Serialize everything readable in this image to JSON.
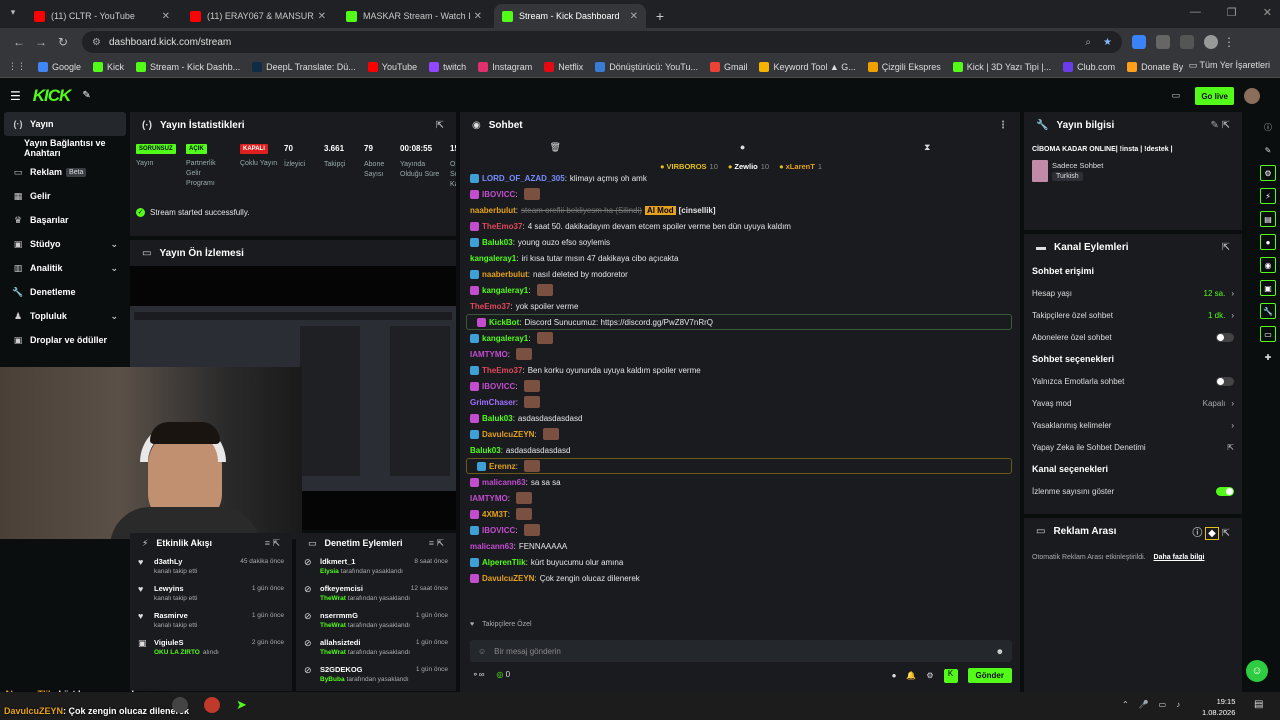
{
  "browser": {
    "tabs": [
      {
        "title": "(11) CLTR - YouTube",
        "color": "#ff0000",
        "active": false
      },
      {
        "title": "(11) ERAY067 & MANSUR",
        "color": "#ff0000",
        "active": false
      },
      {
        "title": "MASKAR Stream - Watch Live o",
        "color": "#53fc18",
        "active": false
      },
      {
        "title": "Stream - Kick Dashboard",
        "color": "#53fc18",
        "active": true
      }
    ],
    "url": "dashboard.kick.com/stream",
    "bookmarks": [
      {
        "label": "Google",
        "color": "#4285f4"
      },
      {
        "label": "Kick",
        "color": "#53fc18"
      },
      {
        "label": "Stream - Kick Dashb...",
        "color": "#53fc18"
      },
      {
        "label": "DeepL Translate: Dü...",
        "color": "#0f2b46"
      },
      {
        "label": "YouTube",
        "color": "#ff0000"
      },
      {
        "label": "twitch",
        "color": "#9146ff"
      },
      {
        "label": "Instagram",
        "color": "#e1306c"
      },
      {
        "label": "Netflix",
        "color": "#e50914"
      },
      {
        "label": "Dönüştürücü: YouTu...",
        "color": "#3a7bd5"
      },
      {
        "label": "Gmail",
        "color": "#ea4335"
      },
      {
        "label": "Keyword Tool ▲ G...",
        "color": "#f4b400"
      },
      {
        "label": "Çizgili Ekspres",
        "color": "#f0a000"
      },
      {
        "label": "Kick | 3D Yazı Tipi |...",
        "color": "#53fc18"
      },
      {
        "label": "Club.com",
        "color": "#6a3de8"
      },
      {
        "label": "Donate ByNoGame...",
        "color": "#ff9f1a"
      }
    ],
    "bookmarks_right": "Tüm Yer İşaretleri"
  },
  "kick": {
    "logo": "KICK",
    "go_live": "Go live"
  },
  "sidebar": {
    "items": [
      {
        "label": "Yayın",
        "icon": "broadcast-icon",
        "active": true
      },
      {
        "label": "Yayın Bağlantısı ve Anahtarı",
        "icon": "",
        "active": false
      },
      {
        "label": "Reklam",
        "icon": "ad-icon",
        "beta": "Beta"
      },
      {
        "label": "Gelir",
        "icon": "money-icon"
      },
      {
        "label": "Başarılar",
        "icon": "trophy-icon"
      },
      {
        "label": "Stüdyo",
        "icon": "studio-icon",
        "chevron": true
      },
      {
        "label": "Analitik",
        "icon": "chart-icon",
        "chevron": true
      },
      {
        "label": "Denetleme",
        "icon": "wrench-icon"
      },
      {
        "label": "Topluluk",
        "icon": "community-icon",
        "chevron": true
      },
      {
        "label": "Droplar ve ödüller",
        "icon": "gift-icon"
      }
    ]
  },
  "stats": {
    "title": "Yayın İstatistikleri",
    "items": [
      {
        "badge": "SORUNSUZ",
        "badge_color": "#53fc18",
        "label": "Yayın"
      },
      {
        "badge": "AÇIK",
        "badge_color": "#53fc18",
        "label": "Partnerlik Gelir Programı"
      },
      {
        "badge": "KAPALI",
        "badge_color": "#e0201f",
        "label": "Çoklu Yayın"
      },
      {
        "value": "70",
        "label": "İzleyici"
      },
      {
        "value": "3.661",
        "label": "Takipçi"
      },
      {
        "value": "79",
        "label": "Abone Sayısı"
      },
      {
        "value": "00:08:55",
        "label": "Yayında Olduğu Süre"
      },
      {
        "value": "15",
        "label": "Or Sc Ka"
      }
    ],
    "success": "Stream started successfully."
  },
  "preview": {
    "title": "Yayın Ön İzlemesi"
  },
  "activity": {
    "title": "Etkinlik Akışı",
    "items": [
      {
        "name": "d3athLy",
        "sub": "kanalı takip etti",
        "time": "45 dakika önce",
        "icon": "heart-icon"
      },
      {
        "name": "Lewyins",
        "sub": "kanalı takip etti",
        "time": "1 gün önce",
        "icon": "heart-icon"
      },
      {
        "name": "Rasmirve",
        "sub": "kanalı takip etti",
        "time": "1 gün önce",
        "icon": "heart-icon"
      },
      {
        "name": "VigiuleS",
        "sub": "OKU LA ZIRTO",
        "sub2": "alındı",
        "time": "2 gün önce",
        "icon": "gift-icon"
      }
    ]
  },
  "modlog": {
    "title": "Denetim Eylemleri",
    "items": [
      {
        "name": "ldkmert_1",
        "by": "Elysia",
        "sub": "tarafından yasaklandı",
        "time": "8 saat önce"
      },
      {
        "name": "ofkeyemcisi",
        "by": "TheWrat",
        "sub": "tarafından yasaklandı",
        "time": "12 saat önce"
      },
      {
        "name": "nserrmmG",
        "by": "TheWrat",
        "sub": "tarafından yasaklandı",
        "time": "1 gün önce"
      },
      {
        "name": "allahsiztedi",
        "by": "TheWrat",
        "sub": "tarafından yasaklandı",
        "time": "1 gün önce"
      },
      {
        "name": "S2GDEKOG",
        "by": "ByBuba",
        "sub": "tarafından yasaklandı",
        "time": "1 gün önce"
      }
    ]
  },
  "chat": {
    "title": "Sohbet",
    "leaders": [
      {
        "name": "VIRBOROS",
        "count": "10"
      },
      {
        "name": "Zewlio",
        "count": "10"
      },
      {
        "name": "xLarenT",
        "count": "1"
      }
    ],
    "messages": [
      {
        "user": "LORD_OF_AZAD_305",
        "color": "#7b8cff",
        "text": "klimayı açmış oh amk"
      },
      {
        "user": "IBOVICC",
        "color": "#c34ccf",
        "text": "",
        "emote": true
      },
      {
        "user": "naaberbulut",
        "color": "#e6a21a",
        "text": "steam oreflii bekliyesm ha (Silindi)",
        "tag": "AI Mod",
        "tag2": "[cinsellik]"
      },
      {
        "user": "TheEmo37",
        "color": "#e0485a",
        "text": "4 saat 50. dakikadayım devam etcem spoiler verme ben dün uyuya kaldım"
      },
      {
        "user": "Baluk03",
        "color": "#53fc18",
        "text": "young ouzo efso soylemis"
      },
      {
        "user": "kangaleray1",
        "color": "#53fc18",
        "text": "iri kısa tutar mısın 47 dakikaya cibo açıcakta"
      },
      {
        "user": "naaberbulut",
        "color": "#e6a21a",
        "text": "nasıl deleted by modoretor"
      },
      {
        "user": "kangaleray1",
        "color": "#53fc18",
        "text": "",
        "emote": true
      },
      {
        "user": "TheEmo37",
        "color": "#e0485a",
        "text": "yok spoiler verme"
      },
      {
        "user": "KickBot",
        "color": "#53fc18",
        "text": "Discord Sunucumuz: https://discord.gg/PwZ8V7nRrQ",
        "highlight": "bot"
      },
      {
        "user": "kangaleray1",
        "color": "#53fc18",
        "text": "",
        "emote": true
      },
      {
        "user": "IAMTYMO",
        "color": "#c34ccf",
        "text": "",
        "emote": true
      },
      {
        "user": "TheEmo37",
        "color": "#e0485a",
        "text": "Ben korku oyununda uyuya kaldım spoiler verme"
      },
      {
        "user": "IBOVICC",
        "color": "#c34ccf",
        "text": "",
        "emote": true
      },
      {
        "user": "GrimChaser",
        "color": "#a070ff",
        "text": "",
        "emote": true
      },
      {
        "user": "Baluk03",
        "color": "#53fc18",
        "text": "asdasdasdasdasd"
      },
      {
        "user": "DavulcuZEYN",
        "color": "#e6a21a",
        "text": "",
        "emote": true
      },
      {
        "user": "Baluk03",
        "color": "#53fc18",
        "text": "asdasdasdasdasd"
      },
      {
        "user": "Erennz",
        "color": "#e6a21a",
        "text": "",
        "emote": true,
        "highlight": "gold"
      },
      {
        "user": "malicann63",
        "color": "#c34ccf",
        "text": "sa sa sa"
      },
      {
        "user": "IAMTYMO",
        "color": "#c34ccf",
        "text": "",
        "emote": true
      },
      {
        "user": "4XM3T",
        "color": "#e6a21a",
        "text": "",
        "emote": true
      },
      {
        "user": "IBOVICC",
        "color": "#c34ccf",
        "text": "",
        "emote": true
      },
      {
        "user": "malicann63",
        "color": "#c34ccf",
        "text": "FENNAAAAA"
      },
      {
        "user": "AlperenTlik",
        "color": "#53fc18",
        "text": "kürt buyucumu olur amına"
      },
      {
        "user": "DavulcuZEYN",
        "color": "#e6a21a",
        "text": "Çok zengin olucaz dilenerek"
      }
    ],
    "follower_label": "Takipçilere Özel",
    "input_placeholder": "Bir mesaj gönderin",
    "send": "Gönder",
    "counter": "0"
  },
  "stream_info": {
    "title": "Yayın bilgisi",
    "stream_title": "CİBOMA KADAR ONLINE| !insta | !destek |",
    "category": "Sadece Sohbet",
    "tag": "Turkish"
  },
  "channel_actions": {
    "title": "Kanal Eylemleri",
    "sec1": "Sohbet erişimi",
    "rows1": [
      {
        "label": "Hesap yaşı",
        "value": "12 sa.",
        "arrow": true
      },
      {
        "label": "Takipçilere özel sohbet",
        "value": "1 dk.",
        "arrow": true
      },
      {
        "label": "Abonelere özel sohbet",
        "toggle": false
      }
    ],
    "sec2": "Sohbet seçenekleri",
    "rows2": [
      {
        "label": "Yalnızca Emotlarla sohbet",
        "toggle": false
      },
      {
        "label": "Yavaş mod",
        "value": "Kapalı",
        "arrow": true
      },
      {
        "label": "Yasaklanmış kelimeler",
        "arrow": true
      },
      {
        "label": "Yapay Zeka ile Sohbet Denetimi",
        "ext": true
      }
    ],
    "sec3": "Kanal seçenekleri",
    "rows3": [
      {
        "label": "İzlenme sayısını göster",
        "toggle": true
      }
    ]
  },
  "ad_break": {
    "title": "Reklam Arası",
    "text": "Otomatik Reklam Arası etkinleştirildi.",
    "link": "Daha fazla bilgi"
  },
  "overlay": {
    "line1_user": "AlperenTlik",
    "line1_text": ": kürt buyucumu olur amına",
    "line2_user": "DavulcuZEYN",
    "line2_text": ": Çok zengin olucaz dilenerek"
  },
  "taskbar": {
    "time": "19:15",
    "date": "1.08.2026"
  },
  "colors": {
    "accent": "#53fc18",
    "panel": "#191b1f",
    "bg": "#0b0e0f"
  }
}
